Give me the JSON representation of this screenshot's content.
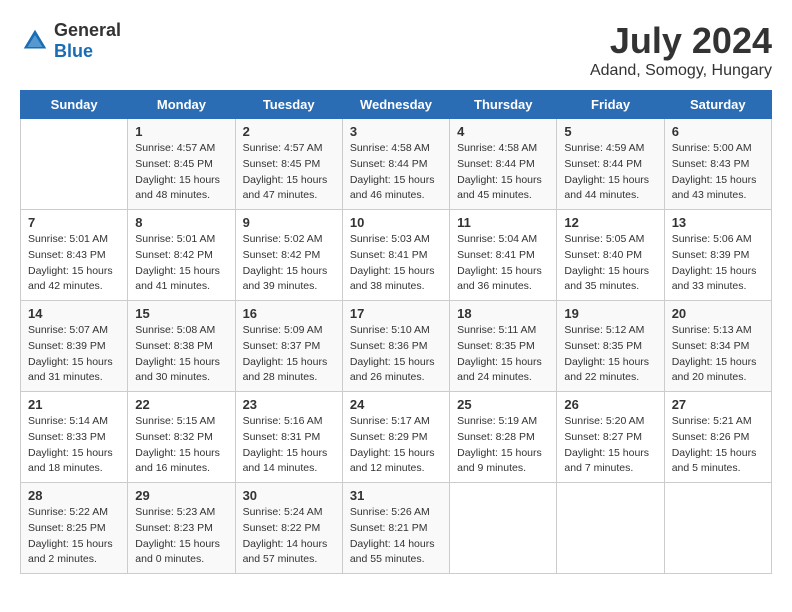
{
  "header": {
    "logo_general": "General",
    "logo_blue": "Blue",
    "title": "July 2024",
    "subtitle": "Adand, Somogy, Hungary"
  },
  "days_of_week": [
    "Sunday",
    "Monday",
    "Tuesday",
    "Wednesday",
    "Thursday",
    "Friday",
    "Saturday"
  ],
  "weeks": [
    {
      "days": [
        {
          "number": "",
          "info": ""
        },
        {
          "number": "1",
          "info": "Sunrise: 4:57 AM\nSunset: 8:45 PM\nDaylight: 15 hours\nand 48 minutes."
        },
        {
          "number": "2",
          "info": "Sunrise: 4:57 AM\nSunset: 8:45 PM\nDaylight: 15 hours\nand 47 minutes."
        },
        {
          "number": "3",
          "info": "Sunrise: 4:58 AM\nSunset: 8:44 PM\nDaylight: 15 hours\nand 46 minutes."
        },
        {
          "number": "4",
          "info": "Sunrise: 4:58 AM\nSunset: 8:44 PM\nDaylight: 15 hours\nand 45 minutes."
        },
        {
          "number": "5",
          "info": "Sunrise: 4:59 AM\nSunset: 8:44 PM\nDaylight: 15 hours\nand 44 minutes."
        },
        {
          "number": "6",
          "info": "Sunrise: 5:00 AM\nSunset: 8:43 PM\nDaylight: 15 hours\nand 43 minutes."
        }
      ]
    },
    {
      "days": [
        {
          "number": "7",
          "info": "Sunrise: 5:01 AM\nSunset: 8:43 PM\nDaylight: 15 hours\nand 42 minutes."
        },
        {
          "number": "8",
          "info": "Sunrise: 5:01 AM\nSunset: 8:42 PM\nDaylight: 15 hours\nand 41 minutes."
        },
        {
          "number": "9",
          "info": "Sunrise: 5:02 AM\nSunset: 8:42 PM\nDaylight: 15 hours\nand 39 minutes."
        },
        {
          "number": "10",
          "info": "Sunrise: 5:03 AM\nSunset: 8:41 PM\nDaylight: 15 hours\nand 38 minutes."
        },
        {
          "number": "11",
          "info": "Sunrise: 5:04 AM\nSunset: 8:41 PM\nDaylight: 15 hours\nand 36 minutes."
        },
        {
          "number": "12",
          "info": "Sunrise: 5:05 AM\nSunset: 8:40 PM\nDaylight: 15 hours\nand 35 minutes."
        },
        {
          "number": "13",
          "info": "Sunrise: 5:06 AM\nSunset: 8:39 PM\nDaylight: 15 hours\nand 33 minutes."
        }
      ]
    },
    {
      "days": [
        {
          "number": "14",
          "info": "Sunrise: 5:07 AM\nSunset: 8:39 PM\nDaylight: 15 hours\nand 31 minutes."
        },
        {
          "number": "15",
          "info": "Sunrise: 5:08 AM\nSunset: 8:38 PM\nDaylight: 15 hours\nand 30 minutes."
        },
        {
          "number": "16",
          "info": "Sunrise: 5:09 AM\nSunset: 8:37 PM\nDaylight: 15 hours\nand 28 minutes."
        },
        {
          "number": "17",
          "info": "Sunrise: 5:10 AM\nSunset: 8:36 PM\nDaylight: 15 hours\nand 26 minutes."
        },
        {
          "number": "18",
          "info": "Sunrise: 5:11 AM\nSunset: 8:35 PM\nDaylight: 15 hours\nand 24 minutes."
        },
        {
          "number": "19",
          "info": "Sunrise: 5:12 AM\nSunset: 8:35 PM\nDaylight: 15 hours\nand 22 minutes."
        },
        {
          "number": "20",
          "info": "Sunrise: 5:13 AM\nSunset: 8:34 PM\nDaylight: 15 hours\nand 20 minutes."
        }
      ]
    },
    {
      "days": [
        {
          "number": "21",
          "info": "Sunrise: 5:14 AM\nSunset: 8:33 PM\nDaylight: 15 hours\nand 18 minutes."
        },
        {
          "number": "22",
          "info": "Sunrise: 5:15 AM\nSunset: 8:32 PM\nDaylight: 15 hours\nand 16 minutes."
        },
        {
          "number": "23",
          "info": "Sunrise: 5:16 AM\nSunset: 8:31 PM\nDaylight: 15 hours\nand 14 minutes."
        },
        {
          "number": "24",
          "info": "Sunrise: 5:17 AM\nSunset: 8:29 PM\nDaylight: 15 hours\nand 12 minutes."
        },
        {
          "number": "25",
          "info": "Sunrise: 5:19 AM\nSunset: 8:28 PM\nDaylight: 15 hours\nand 9 minutes."
        },
        {
          "number": "26",
          "info": "Sunrise: 5:20 AM\nSunset: 8:27 PM\nDaylight: 15 hours\nand 7 minutes."
        },
        {
          "number": "27",
          "info": "Sunrise: 5:21 AM\nSunset: 8:26 PM\nDaylight: 15 hours\nand 5 minutes."
        }
      ]
    },
    {
      "days": [
        {
          "number": "28",
          "info": "Sunrise: 5:22 AM\nSunset: 8:25 PM\nDaylight: 15 hours\nand 2 minutes."
        },
        {
          "number": "29",
          "info": "Sunrise: 5:23 AM\nSunset: 8:23 PM\nDaylight: 15 hours\nand 0 minutes."
        },
        {
          "number": "30",
          "info": "Sunrise: 5:24 AM\nSunset: 8:22 PM\nDaylight: 14 hours\nand 57 minutes."
        },
        {
          "number": "31",
          "info": "Sunrise: 5:26 AM\nSunset: 8:21 PM\nDaylight: 14 hours\nand 55 minutes."
        },
        {
          "number": "",
          "info": ""
        },
        {
          "number": "",
          "info": ""
        },
        {
          "number": "",
          "info": ""
        }
      ]
    }
  ]
}
